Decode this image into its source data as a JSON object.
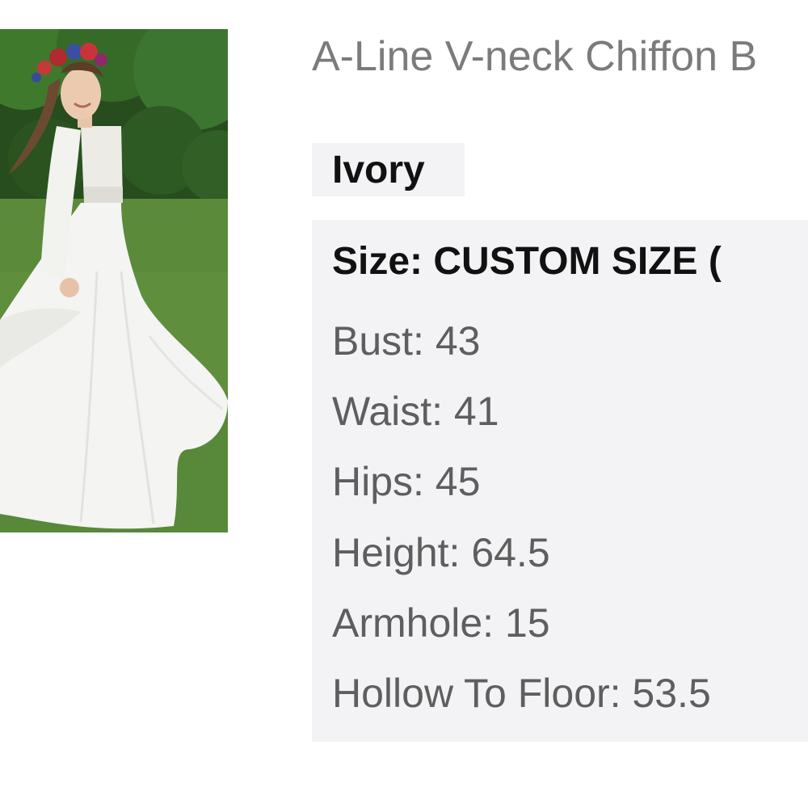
{
  "product": {
    "title": "A-Line V-neck Chiffon B",
    "image_alt": "Model in ivory long-sleeve A-line chiffon gown with flower crown in a garden"
  },
  "color": {
    "selected": "Ivory"
  },
  "size": {
    "heading": "Size: CUSTOM SIZE (",
    "measurements": [
      "Bust: 43",
      "Waist: 41",
      "Hips: 45",
      "Height: 64.5",
      "Armhole: 15",
      "Hollow To Floor: 53.5"
    ]
  },
  "colors": {
    "title_text": "#7b7b7b",
    "panel_bg": "#f3f3f5",
    "measurement_text": "#5e5e5e",
    "heading_text": "#111111"
  }
}
